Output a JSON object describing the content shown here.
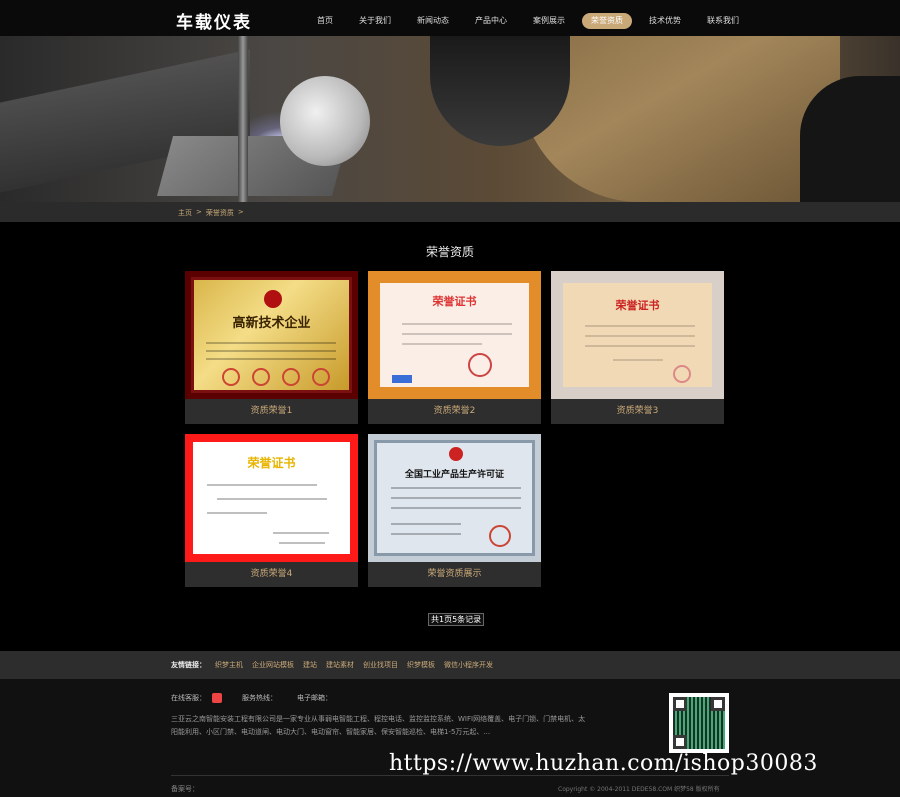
{
  "header": {
    "logo": "车载仪表",
    "nav": [
      "首页",
      "关于我们",
      "新闻动态",
      "产品中心",
      "案例展示",
      "荣誉资质",
      "技术优势",
      "联系我们"
    ],
    "active_index": 5
  },
  "breadcrumb": {
    "home": "主页",
    "sep": ">",
    "current": "荣誉资质",
    "sep2": ">"
  },
  "section": {
    "title": "荣誉资质"
  },
  "cards": [
    {
      "caption": "资质荣誉1",
      "cert_title": "高新技术企业"
    },
    {
      "caption": "资质荣誉2",
      "cert_title": "荣誉证书"
    },
    {
      "caption": "资质荣誉3",
      "cert_title": "荣誉证书"
    },
    {
      "caption": "资质荣誉4",
      "cert_title": "荣誉证书"
    },
    {
      "caption": "荣誉资质展示",
      "cert_title": "全国工业产品生产许可证"
    }
  ],
  "pager": {
    "text": "共1页5条记录"
  },
  "links": {
    "label": "友情链接：",
    "items": [
      "织梦主机",
      "企业网站模板",
      "建站",
      "建站素材",
      "创业找项目",
      "织梦模板",
      "微信小程序开发"
    ]
  },
  "footer": {
    "qq_label": "在线客服：",
    "hotline_label": "服务热线：",
    "email_label": "电子邮箱：",
    "description": "三亚云之南智能安装工程有限公司是一家专业从事弱电智能工程、程控电话、监控监控系统、WIFI网络覆盖、电子门锁、门禁电机、太阳能利用、小区门禁、电动道闸、电动大门、电动窗帘、智能家居、保安智能巡检、电梯1-5万元起、...",
    "icp": "备案号：",
    "copyright": "Copyright © 2004-2011 DEDE58.COM 织梦58 版权所有"
  },
  "watermark": "https://www.huzhan.com/ishop30083",
  "colors": {
    "accent": "#c9a978",
    "background": "#000000",
    "bar": "#2d2d2d"
  }
}
